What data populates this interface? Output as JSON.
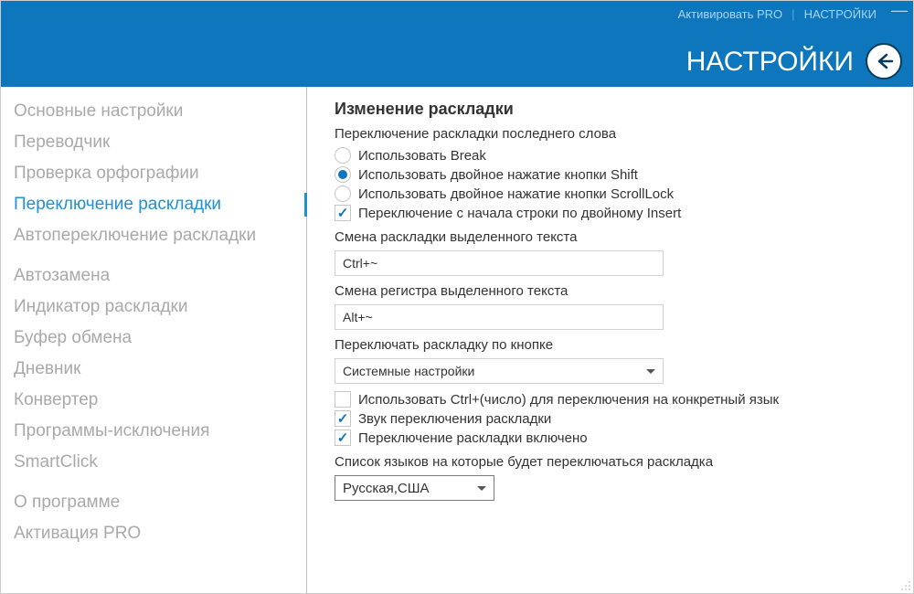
{
  "header": {
    "activate_link": "Активировать PRO",
    "settings_link": "НАСТРОЙКИ",
    "title": "НАСТРОЙКИ"
  },
  "sidebar": {
    "groups": [
      [
        "Основные настройки",
        "Переводчик",
        "Проверка орфографии",
        "Переключение раскладки",
        "Автопереключение раскладки"
      ],
      [
        "Автозамена",
        "Индикатор раскладки",
        "Буфер обмена",
        "Дневник",
        "Конвертер",
        "Программы-исключения",
        "SmartClick"
      ],
      [
        "О программе",
        "Активация PRO"
      ]
    ],
    "active": "Переключение раскладки"
  },
  "content": {
    "section_title": "Изменение раскладки",
    "last_word_label": "Переключение раскладки последнего слова",
    "radios": [
      {
        "label": "Использовать Break",
        "checked": false
      },
      {
        "label": "Использовать двойное нажатие кнопки Shift",
        "checked": true
      },
      {
        "label": "Использовать двойное нажатие кнопки ScrollLock",
        "checked": false
      }
    ],
    "insert_check": {
      "label": "Переключение с начала строки по двойному Insert",
      "checked": true
    },
    "hotkey1_label": "Смена раскладки выделенного текста",
    "hotkey1_value": "Ctrl+~",
    "hotkey2_label": "Смена регистра выделенного текста",
    "hotkey2_value": "Alt+~",
    "switch_by_button_label": "Переключать раскладку по кнопке",
    "switch_by_button_value": "Системные настройки",
    "checks": [
      {
        "label": "Использовать Ctrl+(число) для переключения на конкретный язык",
        "checked": false
      },
      {
        "label": "Звук переключения раскладки",
        "checked": true
      },
      {
        "label": "Переключение раскладки включено",
        "checked": true
      }
    ],
    "lang_list_label": "Список языков на которые будет переключаться раскладка",
    "lang_list_value": "Русская,США"
  }
}
